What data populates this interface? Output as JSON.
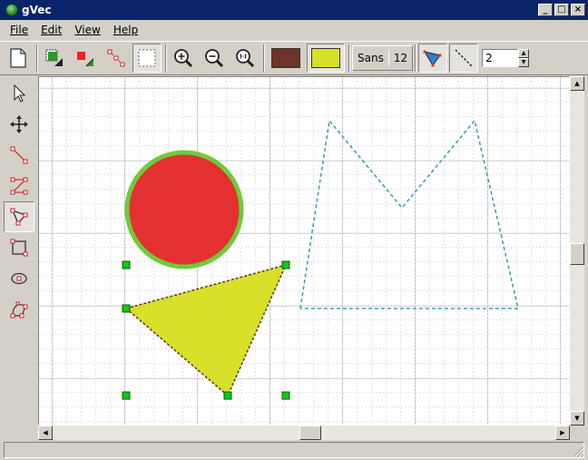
{
  "window": {
    "title": "gVec",
    "minimize": "_",
    "maximize": "□",
    "close": "×"
  },
  "menu": [
    {
      "label": "File"
    },
    {
      "label": "Edit"
    },
    {
      "label": "View"
    },
    {
      "label": "Help"
    }
  ],
  "toolbar": {
    "font_name": "Sans",
    "font_size": "12",
    "line_width": "2",
    "stroke_color": "#6e3428",
    "fill_color": "#d8e02a"
  },
  "canvas": {
    "circle": {
      "fill": "#e43030",
      "stroke": "#6ecb3a"
    },
    "triangle": {
      "fill": "#d8e02a",
      "stroke": "#5a3a1a"
    },
    "polyline": {
      "stroke": "#3fa0b0"
    },
    "handle_color": "#14c814"
  }
}
